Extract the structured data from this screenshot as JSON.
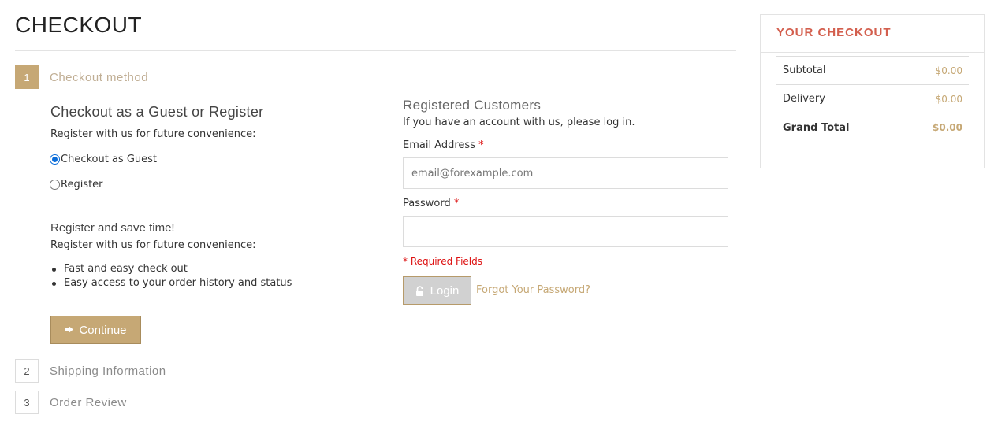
{
  "page": {
    "title": "CHECKOUT"
  },
  "steps": [
    {
      "number": "1",
      "label": "Checkout method",
      "active": true
    },
    {
      "number": "2",
      "label": "Shipping Information",
      "active": false
    },
    {
      "number": "3",
      "label": "Order Review",
      "active": false
    }
  ],
  "guest_section": {
    "title": "Checkout as a Guest or Register",
    "subtitle": "Register with us for future convenience:",
    "options": [
      {
        "label": "Checkout as Guest",
        "checked": true
      },
      {
        "label": "Register",
        "checked": false
      }
    ]
  },
  "save_time": {
    "title": "Register and save time!",
    "subtitle": "Register with us for future convenience:",
    "benefits": [
      "Fast and easy check out",
      "Easy access to your order history and status"
    ]
  },
  "continue_button": {
    "label": "Continue",
    "icon": "arrow-right-icon"
  },
  "registered": {
    "title": "Registered Customers",
    "subtitle": "If you have an account with us, please log in.",
    "email_label": "Email Address",
    "email_placeholder": "email@forexample.com",
    "email_value": "",
    "password_label": "Password",
    "password_value": "",
    "required_marker": "*",
    "required_note": "* Required Fields",
    "login_label": "Login",
    "login_icon": "lock-icon",
    "forgot_label": "Forgot Your Password?"
  },
  "summary": {
    "title": "YOUR CHECKOUT",
    "rows": [
      {
        "label": "Subtotal",
        "amount": "$0.00"
      },
      {
        "label": "Delivery",
        "amount": "$0.00"
      },
      {
        "label": "Grand Total",
        "amount": "$0.00"
      }
    ]
  },
  "colors": {
    "accent_gold": "#c6a875",
    "summary_title": "#d35f4e",
    "required_red": "#dd1111",
    "radio_blue": "#0a6cd9"
  }
}
